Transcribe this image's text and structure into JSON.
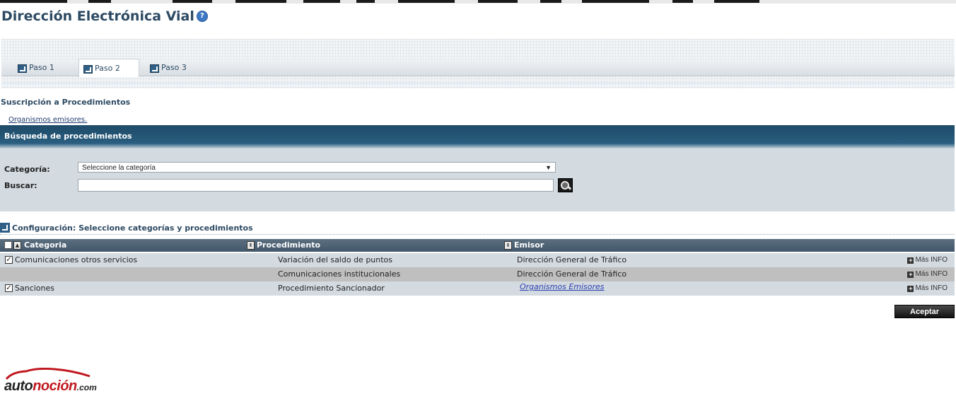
{
  "page": {
    "title": "Dirección Electrónica Vial",
    "help_icon": "?"
  },
  "steps": [
    {
      "label": "Paso 1"
    },
    {
      "label": "Paso 2"
    },
    {
      "label": "Paso 3"
    }
  ],
  "steps_active": "Paso 2",
  "section": {
    "title": "Suscripción a Procedimientos",
    "org_link": "Organismos emisores."
  },
  "search": {
    "header": "Búsqueda de procedimientos",
    "category_label": "Categoría:",
    "category_value": "Seleccione la categoría",
    "search_label": "Buscar:",
    "search_value": ""
  },
  "config": {
    "title": "Configuración: Seleccione categorías y procedimientos"
  },
  "table": {
    "columns": [
      "Categoria",
      "Procedimiento",
      "Emisor"
    ],
    "rows": [
      {
        "checked": true,
        "categoria": "Comunicaciones otros servicios",
        "procedimiento": "Variación del saldo de puntos",
        "emisor": "Dirección General de Tráfico",
        "mas_info": "Más INFO"
      },
      {
        "checked": false,
        "categoria": "",
        "procedimiento": "Comunicaciones institucionales",
        "emisor": "Dirección General de Tráfico",
        "mas_info": "Más INFO"
      },
      {
        "checked": true,
        "categoria": "Sanciones",
        "procedimiento": "Procedimiento Sancionador",
        "emisor": "Organismos Emisores",
        "mas_info": "Más INFO"
      }
    ]
  },
  "actions": {
    "accept": "Aceptar"
  },
  "watermark": {
    "part1": "auto",
    "part2": "noción",
    "part3": ".com"
  },
  "colors": {
    "title": "#2d4a63",
    "header_band": "#1e4b68",
    "row_light": "#d3dae0",
    "row_dark": "#bfbfbf",
    "accent_red": "#c0181f"
  },
  "icons": {
    "help": "help-icon",
    "step": "arrow-box-icon",
    "search": "magnifier-icon",
    "sort": "sort-icon",
    "checkbox": "checkbox-icon",
    "plus": "plus-icon"
  }
}
